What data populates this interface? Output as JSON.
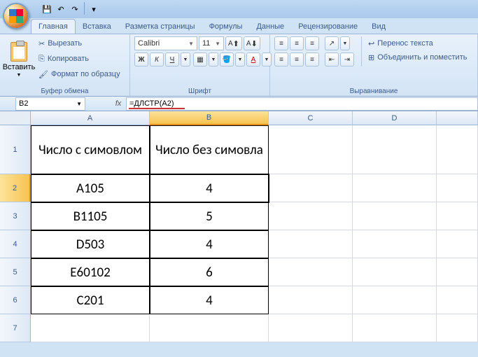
{
  "qat": {
    "save": "💾",
    "undo": "↶",
    "redo": "↷"
  },
  "tabs": [
    "Главная",
    "Вставка",
    "Разметка страницы",
    "Формулы",
    "Данные",
    "Рецензирование",
    "Вид"
  ],
  "active_tab": 0,
  "ribbon": {
    "clipboard": {
      "paste": "Вставить",
      "cut": "Вырезать",
      "copy": "Копировать",
      "format_painter": "Формат по образцу",
      "label": "Буфер обмена"
    },
    "font": {
      "name": "Calibri",
      "size": "11",
      "label": "Шрифт",
      "bold": "Ж",
      "italic": "К",
      "underline": "Ч"
    },
    "alignment": {
      "wrap": "Перенос текста",
      "merge": "Объединить и поместить",
      "label": "Выравнивание"
    }
  },
  "namebox": "B2",
  "formula": "=ДЛСТР(A2)",
  "columns": [
    {
      "name": "A",
      "width": 170
    },
    {
      "name": "B",
      "width": 170,
      "selected": true
    },
    {
      "name": "C",
      "width": 120
    },
    {
      "name": "D",
      "width": 120
    },
    {
      "name": "",
      "width": 59
    }
  ],
  "rows": [
    {
      "n": "1",
      "h": 70,
      "cells": [
        {
          "v": "Число с симовлом",
          "b": 1
        },
        {
          "v": "Число без симовла",
          "b": 1
        },
        {
          "v": ""
        },
        {
          "v": ""
        },
        {
          "v": ""
        }
      ]
    },
    {
      "n": "2",
      "h": 40,
      "sel": true,
      "cells": [
        {
          "v": "A105",
          "b": 1
        },
        {
          "v": "4",
          "b": 1,
          "active": 1
        },
        {
          "v": ""
        },
        {
          "v": ""
        },
        {
          "v": ""
        }
      ]
    },
    {
      "n": "3",
      "h": 40,
      "cells": [
        {
          "v": "B1105",
          "b": 1
        },
        {
          "v": "5",
          "b": 1
        },
        {
          "v": ""
        },
        {
          "v": ""
        },
        {
          "v": ""
        }
      ]
    },
    {
      "n": "4",
      "h": 40,
      "cells": [
        {
          "v": "D503",
          "b": 1
        },
        {
          "v": "4",
          "b": 1
        },
        {
          "v": ""
        },
        {
          "v": ""
        },
        {
          "v": ""
        }
      ]
    },
    {
      "n": "5",
      "h": 40,
      "cells": [
        {
          "v": "E60102",
          "b": 1
        },
        {
          "v": "6",
          "b": 1
        },
        {
          "v": ""
        },
        {
          "v": ""
        },
        {
          "v": ""
        }
      ]
    },
    {
      "n": "6",
      "h": 40,
      "cells": [
        {
          "v": "C201",
          "b": 1
        },
        {
          "v": "4",
          "b": 1
        },
        {
          "v": ""
        },
        {
          "v": ""
        },
        {
          "v": ""
        }
      ]
    },
    {
      "n": "7",
      "h": 40,
      "cells": [
        {
          "v": ""
        },
        {
          "v": ""
        },
        {
          "v": ""
        },
        {
          "v": ""
        },
        {
          "v": ""
        }
      ]
    }
  ]
}
